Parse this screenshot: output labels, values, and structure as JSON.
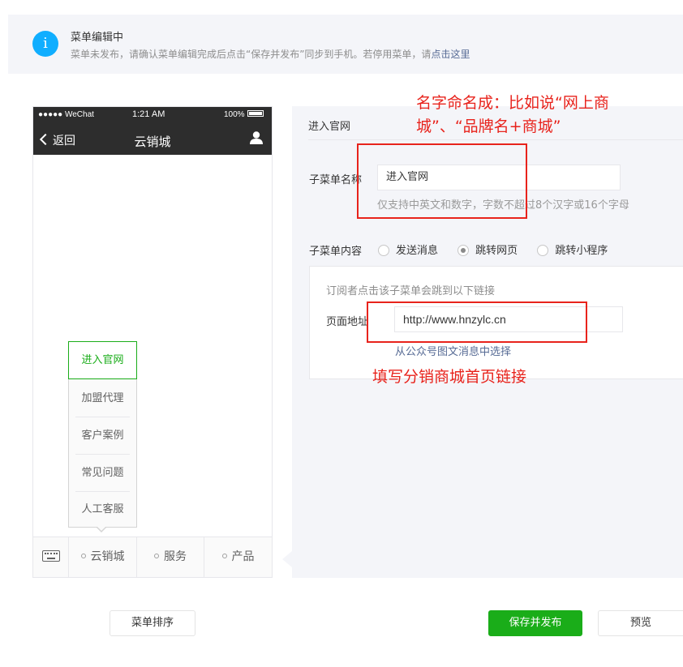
{
  "notice": {
    "icon": "info-icon",
    "icon_glyph": "i",
    "title": "菜单编辑中",
    "desc": "菜单未发布，请确认菜单编辑完成后点击“保存并发布”同步到手机。若停用菜单，请",
    "link": "点击这里"
  },
  "phone": {
    "status": {
      "carrier": "●●●●● WeChat",
      "time": "1:21 AM",
      "battery": "100%"
    },
    "nav": {
      "back": "返回",
      "title": "云销城"
    },
    "submenu": [
      "进入官网",
      "加盟代理",
      "客户案例",
      "常见问题",
      "人工客服"
    ],
    "menubar": [
      "云销城",
      "服务",
      "产品"
    ]
  },
  "panel": {
    "header": "进入官网",
    "name_label": "子菜单名称",
    "name_value": "进入官网",
    "name_tip": "仅支持中英文和数字，字数不超过8个汉字或16个字母",
    "content_label": "子菜单内容",
    "options": [
      "发送消息",
      "跳转网页",
      "跳转小程序"
    ],
    "selected_option": "跳转网页",
    "url_tip": "订阅者点击该子菜单会跳到以下链接",
    "url_label": "页面地址",
    "url_value": "http://www.hnzylc.cn",
    "url_pick": "从公众号图文消息中选择"
  },
  "annotations": {
    "top_line1": "名字命名成：比如说“网上商",
    "top_line2": "城”、“品牌名+商城”",
    "bottom": "填写分销商城首页链接",
    "color": "#e8231c"
  },
  "buttons": {
    "sort": "菜单排序",
    "publish": "保存并发布",
    "preview": "预览"
  },
  "colors": {
    "accent": "#1aad19",
    "info": "#10aeff",
    "link": "#576b95"
  }
}
